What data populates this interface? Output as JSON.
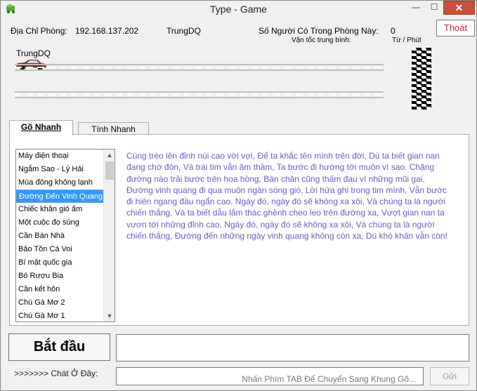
{
  "window": {
    "title": "Type - Game",
    "minimize": "—",
    "maximize": "☐",
    "close": "✕"
  },
  "header": {
    "ip_label": "Địa Chỉ Phòng:",
    "ip_value": "192.168.137.202",
    "user": "TrungDQ",
    "count_label": "Số Người Có Trong Phòng Này:",
    "count_value": "0",
    "exit_button": "Thoát",
    "speed_label": "Vận tốc trung bình:",
    "speed_unit": "Từ / Phút"
  },
  "race": {
    "player_name": "TrungDQ"
  },
  "tabs": [
    {
      "label": "Gõ Nhanh",
      "active": true
    },
    {
      "label": "Tính Nhanh",
      "active": false
    }
  ],
  "songs": [
    "Máy điện thoại",
    "Ngắm Sao - Lý Hải",
    "Mùa đông không lạnh",
    "Đường Đến Vinh Quang",
    "Chiếc khăn gió ấm",
    "Một cuộc đọ súng",
    "Cần Bán Nhà",
    "Bảo Tồn Cá Voi",
    "Bí mật quốc gia",
    "Bó Rượu Bia",
    "Cần kết hôn",
    "Chú Gà Mơ 2",
    "Chú Gà Mơ 1"
  ],
  "selected_song_index": 3,
  "lyrics": "Cùng trèo lên đỉnh núi cao vời vợi, Để ta khắc tên mình trên đời, Dù ta biết gian nan đang chờ đón, Và trái tim vẫn âm thầm, Ta bước đi hướng tới muôn vì sao. Chặng đường nào trải bước trên hoa hồng, Bàn chân cũng thấm đau vì những mũi gai, Đường vinh quang đi qua muôn ngàn sóng gió, Lời hứa ghi trong tim mình, Vẫn bước đi hiên ngang đầu ngẩn cao. Ngày đó, ngày đó sẽ không xa xôi, Và chúng ta là người chiến thắng, Và ta biết dẫu lắm thác ghềnh cheo leo trên đường xa, Vượt gian nan ta vươn tới những đỉnh cao. Ngày đó, ngày đó sẽ không xa xôi, Và chúng ta là người chiến thắng, Đường đến những ngày vinh quang không còn xa, Dù khó khăn vẫn còn!",
  "start_button": "Bắt đầu",
  "chat": {
    "label": ">>>>>>> Chát Ở Đây:",
    "placeholder": "Nhấn Phím TAB Để Chuyển Sang Khung Gõ...",
    "send": "Gửi"
  },
  "colors": {
    "lyrics": "#6a5acd",
    "selected": "#3399ff",
    "exit": "#c0302a"
  }
}
